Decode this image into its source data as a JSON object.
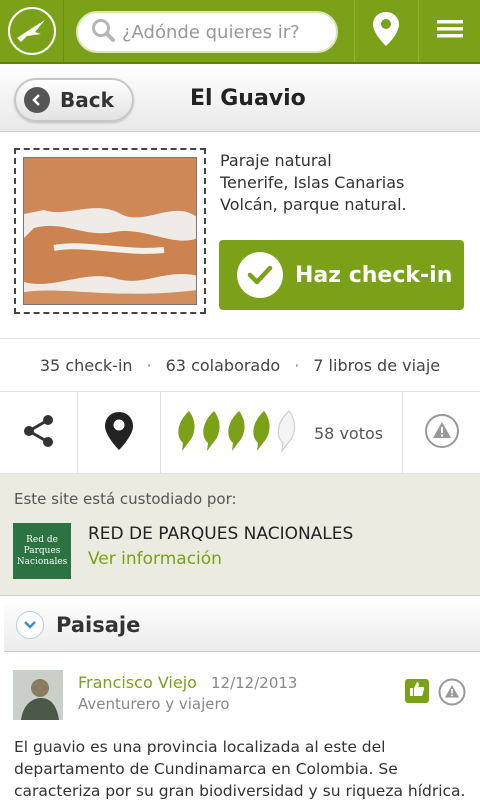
{
  "topbar": {
    "search_placeholder": "¿Adónde quieres ir?",
    "logo_icon": "bird-logo-icon",
    "location_icon": "map-pin-icon",
    "menu_icon": "hamburger-menu-icon"
  },
  "header": {
    "back_label": "Back",
    "title": "El Guavio"
  },
  "site": {
    "info_lines": [
      "Paraje natural",
      "Tenerife, Islas Canarias",
      "Volcán, parque natural."
    ],
    "checkin_label": "Haz check-in"
  },
  "stats": {
    "checkins": "35 check-in",
    "collaborators": "63 colaborado",
    "books": "7 libros de viaje",
    "separator": "·"
  },
  "rating": {
    "leaves_filled": 4,
    "leaves_total": 5,
    "votes": "58 votos"
  },
  "custodian": {
    "label": "Este site está custodiado por:",
    "logo_lines": [
      "Red de",
      "Parques",
      "Nacionales"
    ],
    "name": "RED DE PARQUES NACIONALES",
    "link": "Ver información"
  },
  "section": {
    "title": "Paisaje"
  },
  "comment": {
    "author": "Francisco Viejo",
    "date": "12/12/2013",
    "role": "Aventurero y viajero",
    "text": "El guavio es una provincia localizada al este del departamento de Cundinamarca en Colombia. Se caracteriza por su gran biodiversidad y su riqueza hídrica."
  },
  "colors": {
    "accent": "#7aa118",
    "custodian_bg": "#ecebe1",
    "custodian_logo": "#2b7340"
  }
}
